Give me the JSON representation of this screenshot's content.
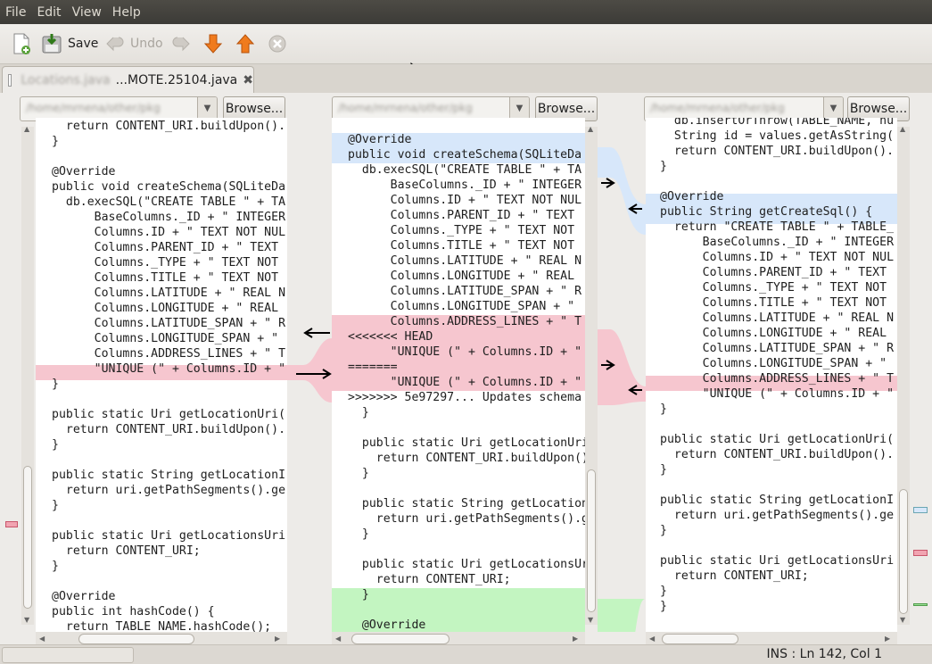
{
  "menu": {
    "items": [
      "File",
      "Edit",
      "View",
      "Help"
    ]
  },
  "toolbar": {
    "save_label": "Save",
    "undo_label": "Undo"
  },
  "tab": {
    "blurred_name": "Locations.java",
    "label": "...MOTE.25104.java"
  },
  "panes": {
    "browse_label": "Browse...",
    "path_left": "/home/mrnena/other/pkg",
    "path_mid": "/home/mrnena/other/pkg",
    "path_right": "/home/mrnena/other/pkg"
  },
  "left_lines": [
    "  return CONTENT_URI.buildUpon().",
    "}",
    "",
    "@Override",
    "public void createSchema(SQLiteDa",
    "  db.execSQL(\"CREATE TABLE \" + TA",
    "      BaseColumns._ID + \" INTEGER",
    "      Columns.ID + \" TEXT NOT NUL",
    "      Columns.PARENT_ID + \" TEXT",
    "      Columns._TYPE + \" TEXT NOT",
    "      Columns.TITLE + \" TEXT NOT",
    "      Columns.LATITUDE + \" REAL N",
    "      Columns.LONGITUDE + \" REAL",
    "      Columns.LATITUDE_SPAN + \" R",
    "      Columns.LONGITUDE_SPAN + \"",
    "      Columns.ADDRESS_LINES + \" T",
    "      \"UNIQUE (\" + Columns.ID + \"",
    "}",
    "",
    "public static Uri getLocationUri(",
    "  return CONTENT_URI.buildUpon().",
    "}",
    "",
    "public static String getLocationI",
    "  return uri.getPathSegments().ge",
    "}",
    "",
    "public static Uri getLocationsUri",
    "  return CONTENT_URI;",
    "}",
    "",
    "@Override",
    "public int hashCode() {",
    "  return TABLE_NAME.hashCode();"
  ],
  "mid_lines": [
    "",
    "@Override",
    "public void createSchema(SQLiteDa",
    "  db.execSQL(\"CREATE TABLE \" + TA",
    "      BaseColumns._ID + \" INTEGER",
    "      Columns.ID + \" TEXT NOT NUL",
    "      Columns.PARENT_ID + \" TEXT",
    "      Columns._TYPE + \" TEXT NOT",
    "      Columns.TITLE + \" TEXT NOT",
    "      Columns.LATITUDE + \" REAL N",
    "      Columns.LONGITUDE + \" REAL",
    "      Columns.LATITUDE_SPAN + \" R",
    "      Columns.LONGITUDE_SPAN + \"",
    "      Columns.ADDRESS_LINES + \" T",
    "<<<<<<< HEAD",
    "      \"UNIQUE (\" + Columns.ID + \"",
    "=======",
    "      \"UNIQUE (\" + Columns.ID + \"",
    ">>>>>>> 5e97297... Updates schema f",
    "  }",
    "",
    "  public static Uri getLocationUri(",
    "    return CONTENT_URI.buildUpon().",
    "  }",
    "",
    "  public static String getLocationI",
    "    return uri.getPathSegments().ge",
    "  }",
    "",
    "  public static Uri getLocationsUri",
    "    return CONTENT_URI;",
    "  }",
    "",
    "  @Override"
  ],
  "right_lines": [
    "  db.insertOrThrow(TABLE_NAME, nu",
    "  String id = values.getAsString(",
    "  return CONTENT_URI.buildUpon().",
    "}",
    "",
    "@Override",
    "public String getCreateSql() {",
    "  return \"CREATE TABLE \" + TABLE_",
    "      BaseColumns._ID + \" INTEGER",
    "      Columns.ID + \" TEXT NOT NUL",
    "      Columns.PARENT_ID + \" TEXT",
    "      Columns._TYPE + \" TEXT NOT",
    "      Columns.TITLE + \" TEXT NOT",
    "      Columns.LATITUDE + \" REAL N",
    "      Columns.LONGITUDE + \" REAL",
    "      Columns.LATITUDE_SPAN + \" R",
    "      Columns.LONGITUDE_SPAN + \"",
    "      Columns.ADDRESS_LINES + \" T",
    "      \"UNIQUE (\" + Columns.ID + \"",
    "}",
    "",
    "public static Uri getLocationUri(",
    "  return CONTENT_URI.buildUpon().",
    "}",
    "",
    "public static String getLocationI",
    "  return uri.getPathSegments().ge",
    "}",
    "",
    "public static Uri getLocationsUri",
    "  return CONTENT_URI;",
    "}",
    "}"
  ],
  "status": {
    "text": "INS : Ln 142, Col 1"
  },
  "colors": {
    "conflict": "#f6c6cf",
    "changed": "#d7e7fa",
    "inserted": "#c3f5c1",
    "highlight": "#c0002a"
  }
}
